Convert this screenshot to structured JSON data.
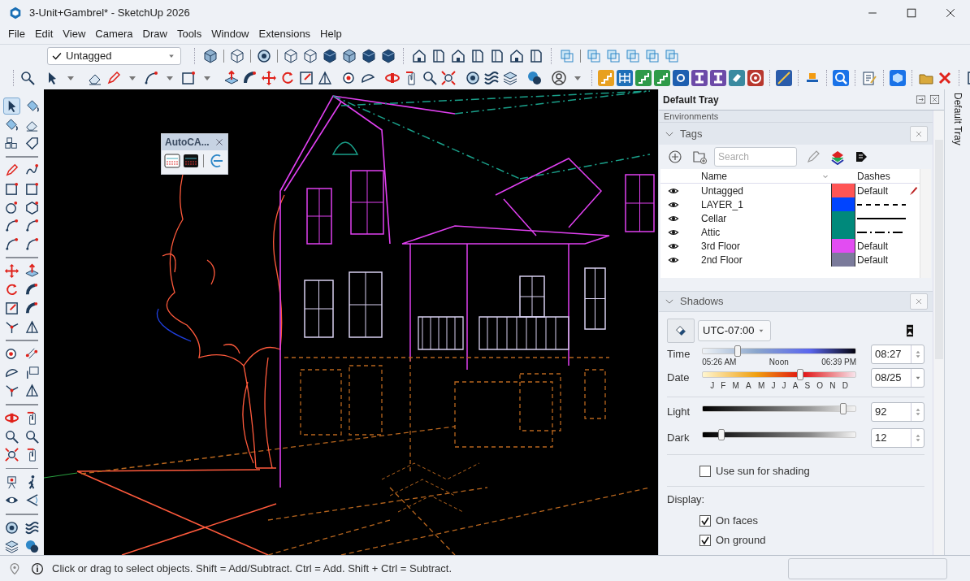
{
  "window": {
    "title": "3-Unit+Gambrel* - SketchUp 2026"
  },
  "menu": [
    {
      "label": "File"
    },
    {
      "label": "Edit"
    },
    {
      "label": "View"
    },
    {
      "label": "Camera"
    },
    {
      "label": "Draw"
    },
    {
      "label": "Tools"
    },
    {
      "label": "Window"
    },
    {
      "label": "Extensions"
    },
    {
      "label": "Help"
    }
  ],
  "tag_dropdown": {
    "value": "Untagged"
  },
  "autocad_palette": {
    "title": "AutoCA..."
  },
  "tray": {
    "title": "Default Tray",
    "side_tab": "Default Tray",
    "collapsed_panel": "Environments",
    "tags": {
      "title": "Tags",
      "search_placeholder": "Search",
      "columns": [
        "Name",
        "Dashes"
      ],
      "rows": [
        {
          "name": "Untagged",
          "visible": true,
          "current": true,
          "color": "#ff5555",
          "kind": "label",
          "dashes": "Default"
        },
        {
          "name": "LAYER_1",
          "visible": true,
          "current": false,
          "color": "#0044ff",
          "kind": "dashed"
        },
        {
          "name": "Cellar",
          "visible": true,
          "current": false,
          "color": "#00897b",
          "kind": "solid"
        },
        {
          "name": "Attic",
          "visible": true,
          "current": false,
          "color": "#00897b",
          "kind": "dash-dot"
        },
        {
          "name": "3rd Floor",
          "visible": true,
          "current": false,
          "color": "#e24cf2",
          "kind": "label",
          "dashes": "Default"
        },
        {
          "name": "2nd Floor",
          "visible": true,
          "current": false,
          "color": "#7b7b9b",
          "kind": "label",
          "dashes": "Default"
        }
      ]
    },
    "shadows": {
      "title": "Shadows",
      "timezone": "UTC-07:00",
      "time": {
        "label": "Time",
        "level": 0.23,
        "ticks": [
          "05:26 AM",
          "Noon",
          "06:39 PM"
        ],
        "value": "08:27"
      },
      "date": {
        "label": "Date",
        "level": 0.64,
        "months": [
          "J",
          "F",
          "M",
          "A",
          "M",
          "J",
          "J",
          "A",
          "S",
          "O",
          "N",
          "D"
        ],
        "value": "08/25"
      },
      "light": {
        "label": "Light",
        "level": 0.92,
        "value": "92"
      },
      "dark": {
        "label": "Dark",
        "level": 0.12,
        "value": "12"
      },
      "use_sun": {
        "label": "Use sun for shading",
        "checked": false
      },
      "display_label": "Display:",
      "display": [
        {
          "label": "On faces",
          "checked": true
        },
        {
          "label": "On ground",
          "checked": true
        }
      ]
    }
  },
  "status_bar": {
    "message": "Click or drag to select objects. Shift = Add/Subtract. Ctrl = Add. Shift + Ctrl = Subtract."
  }
}
